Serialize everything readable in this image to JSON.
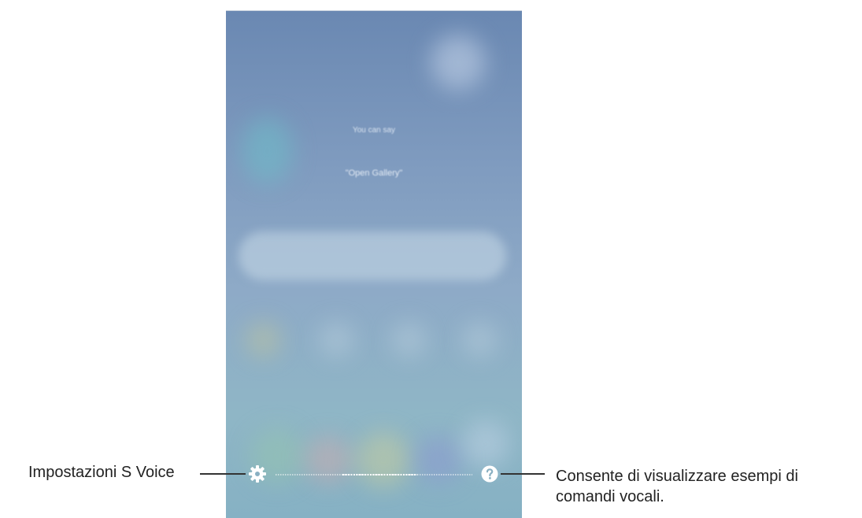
{
  "screen": {
    "hint_caption": "You can say",
    "hint_example": "\"Open Gallery\""
  },
  "bottom_bar": {
    "settings_icon": "gear-icon",
    "help_icon": "question-circle-icon",
    "wave_icon": "voice-wave-icon"
  },
  "callouts": {
    "settings_label": "Impostazioni S Voice",
    "help_label": "Consente di visualizzare esempi di comandi vocali."
  },
  "colors": {
    "screen_top": "#6a88b2",
    "screen_bottom": "#86b1c4",
    "text": "#222222",
    "leader": "#333333"
  }
}
